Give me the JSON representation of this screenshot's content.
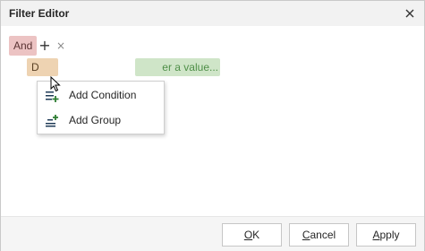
{
  "window": {
    "title": "Filter Editor",
    "close_icon": "close-icon"
  },
  "filter": {
    "group_operator": "And",
    "add_glyph": "+",
    "remove_glyph": "×",
    "condition": {
      "field_visible": "D",
      "value_visible": "er a value..."
    }
  },
  "context_menu": {
    "items": [
      {
        "label": "Add Condition",
        "icon": "add-condition-icon"
      },
      {
        "label": "Add Group",
        "icon": "add-group-icon"
      }
    ]
  },
  "footer": {
    "ok": {
      "mnemonic": "O",
      "rest": "K"
    },
    "cancel": {
      "mnemonic": "C",
      "rest": "ancel"
    },
    "apply": {
      "mnemonic": "A",
      "rest": "pply"
    }
  },
  "colors": {
    "group_chip": "#ecc3c3",
    "field_chip": "#eed3b2",
    "value_chip": "#cfe5c8",
    "menu_icon_accent": "#2e7d32",
    "menu_icon_dark": "#1f3b57"
  }
}
